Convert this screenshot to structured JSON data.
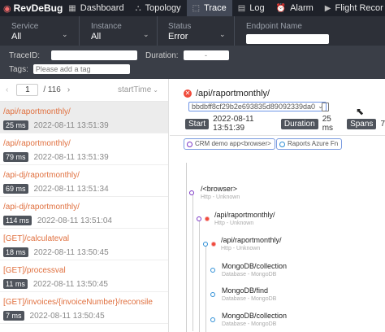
{
  "brand": {
    "name": "RevDeBug"
  },
  "nav": [
    {
      "label": "Dashboard",
      "icon": "dashboard-icon"
    },
    {
      "label": "Topology",
      "icon": "topology-icon"
    },
    {
      "label": "Trace",
      "icon": "trace-icon",
      "active": true
    },
    {
      "label": "Log",
      "icon": "log-icon"
    },
    {
      "label": "Alarm",
      "icon": "alarm-icon"
    },
    {
      "label": "Flight Recor",
      "icon": "flight-recorder-icon"
    }
  ],
  "filters": {
    "service": {
      "label": "Service",
      "value": "All"
    },
    "instance": {
      "label": "Instance",
      "value": "All"
    },
    "status": {
      "label": "Status",
      "value": "Error"
    },
    "endpoint": {
      "label": "Endpoint Name",
      "value": ""
    }
  },
  "trace_bar": {
    "traceid_label": "TraceID:",
    "traceid_value": "",
    "duration_label": "Duration:",
    "duration_sep": "-",
    "tags_label": "Tags:",
    "tags_placeholder": "Please add a tag"
  },
  "pager": {
    "page": "1",
    "total": "/ 116",
    "sort": "startTime"
  },
  "traces": [
    {
      "endpoint": "/api/raportmonthly/",
      "duration": "25 ms",
      "time": "2022-08-11 13:51:39",
      "selected": true
    },
    {
      "endpoint": "/api/raportmonthly/",
      "duration": "79 ms",
      "time": "2022-08-11 13:51:39"
    },
    {
      "endpoint": "/api-dj/raportmonthly/",
      "duration": "69 ms",
      "time": "2022-08-11 13:51:34"
    },
    {
      "endpoint": "/api-dj/raportmonthly/",
      "duration": "114 ms",
      "time": "2022-08-11 13:51:04"
    },
    {
      "endpoint": "[GET]/calculateval",
      "duration": "18 ms",
      "time": "2022-08-11 13:50:45"
    },
    {
      "endpoint": "[GET]/processval",
      "duration": "11 ms",
      "time": "2022-08-11 13:50:45"
    },
    {
      "endpoint": "[GET]/invoices/{invoiceNumber}/reconsile",
      "duration": "7 ms",
      "time": "2022-08-11 13:50:45"
    }
  ],
  "detail": {
    "endpoint": "/api/raportmonthly/",
    "trace_id": "bbdbff8cf29b2e693835d89092339da0",
    "start_label": "Start",
    "start_value": "2022-08-11 13:51:39",
    "duration_label": "Duration",
    "duration_value": "25 ms",
    "spans_label": "Spans",
    "spans_value": "7",
    "services": [
      {
        "name": "CRM demo app<browser>",
        "color": "#7b36c6"
      },
      {
        "name": "Raports Azure Fn",
        "color": "#2d8ed6"
      }
    ],
    "spans": [
      {
        "name": "/<browser>",
        "component": "Http - Unknown",
        "color": "#7b36c6",
        "error": false
      },
      {
        "name": "/api/raportmonthly/",
        "component": "Http - Unknown",
        "color": "#7b36c6",
        "error": true
      },
      {
        "name": "/api/raportmonthly/",
        "component": "Http - Unknown",
        "color": "#2d8ed6",
        "error": true
      },
      {
        "name": "MongoDB/collection",
        "component": "Database - MongoDB",
        "color": "#2d8ed6",
        "error": false
      },
      {
        "name": "MongoDB/find",
        "component": "Database - MongoDB",
        "color": "#2d8ed6",
        "error": false
      },
      {
        "name": "MongoDB/collection",
        "component": "Database - MongoDB",
        "color": "#2d8ed6",
        "error": false
      }
    ]
  }
}
